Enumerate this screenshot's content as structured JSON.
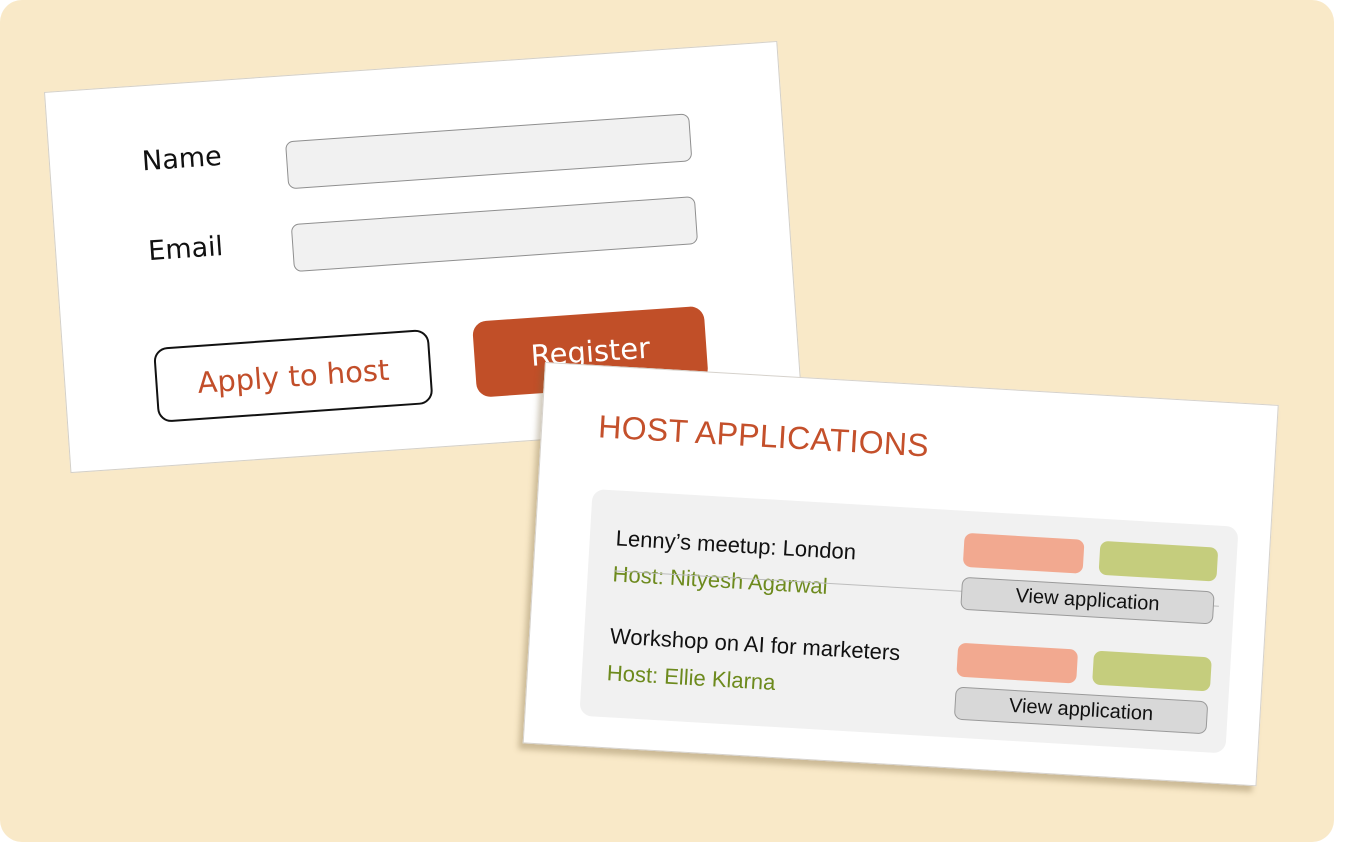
{
  "registration_form": {
    "name_label": "Name",
    "name_value": "",
    "email_label": "Email",
    "email_value": "",
    "apply_button_label": "Apply to host",
    "register_button_label": "Register"
  },
  "host_applications": {
    "title": "HOST APPLICATIONS",
    "applications": [
      {
        "event": "Lenny’s meetup: London",
        "host": "Host: Nityesh Agarwal",
        "view_label": "View application"
      },
      {
        "event": "Workshop on AI for marketers",
        "host": "Host: Ellie Klarna",
        "view_label": "View application"
      }
    ]
  },
  "colors": {
    "background": "#f9e9c8",
    "accent": "#c14f28",
    "host_text": "#6d8a1d",
    "reject": "#f2a990",
    "approve": "#c5cd7d"
  }
}
